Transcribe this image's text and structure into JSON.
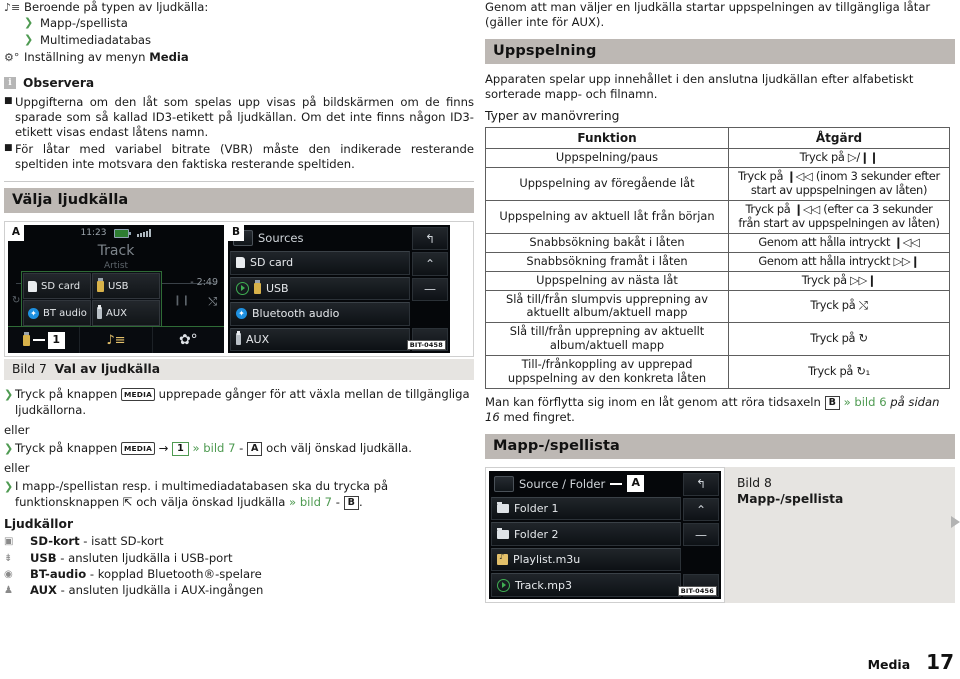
{
  "left": {
    "intro": {
      "icon": "playlist-icon",
      "text": "Beroende på typen av ljudkälla:",
      "subitems": [
        "Mapp-/spellista",
        "Multimediadatabas"
      ],
      "setting_icon": "gear-icon",
      "setting_text_prefix": "Inställning av menyn ",
      "setting_text_bold": "Media"
    },
    "note": {
      "badge": "i",
      "title": "Observera",
      "items": [
        "Uppgifterna om den låt som spelas upp visas på bildskärmen om de finns sparade som så kallad ID3-etikett på ljudkällan. Om det inte finns någon ID3-etikett visas endast låtens namn.",
        "För låtar med variabel bitrate (VBR) måste den indikerade resterande speltiden inte motsvara den faktiska resterande speltiden."
      ]
    },
    "section_title": "Välja ljudkälla",
    "screen_a": {
      "label": "A",
      "time": "11:23",
      "track": "Track",
      "artist": "Artist",
      "remaining": "- 2:49",
      "popup_items": [
        {
          "label": "SD card",
          "icon": "sd-card-icon"
        },
        {
          "label": "USB",
          "icon": "usb-icon"
        },
        {
          "label": "BT audio",
          "icon": "bluetooth-icon"
        },
        {
          "label": "AUX",
          "icon": "aux-icon"
        }
      ],
      "callout_number": "1",
      "bottom_icons": [
        "usb-icon",
        "playlist-icon",
        "gear-icon"
      ]
    },
    "screen_b": {
      "label": "B",
      "title": "Sources",
      "back_icon": "back-arrow-icon",
      "items": [
        {
          "label": "SD card",
          "icon": "sd-card-icon",
          "playing": false
        },
        {
          "label": "USB",
          "icon": "usb-icon",
          "playing": true
        },
        {
          "label": "Bluetooth audio",
          "icon": "bluetooth-icon",
          "playing": false
        },
        {
          "label": "AUX",
          "icon": "aux-icon",
          "playing": false
        }
      ],
      "side_icons": [
        "up-chevron-icon",
        "scroll-handle-icon",
        "down-chevron-icon"
      ],
      "bit_code": "BIT-0458"
    },
    "caption": {
      "number": "Bild 7",
      "title": "Val av ljudkälla"
    },
    "steps": [
      {
        "pre": "Tryck på knappen ",
        "key": "MEDIA",
        "post": " upprepade gånger för att växla mellan de tillgängliga ljudkällorna."
      },
      {
        "pre": "Tryck på knappen ",
        "key": "MEDIA",
        "arrow": "→",
        "num": "1",
        "ref": "» bild 7",
        "dash": "-",
        "letter": "A",
        "post": " och välj önskad ljudkälla."
      },
      {
        "pre": "I mapp-/spellistan resp. i multimediadatabasen ska du trycka på funktionsknappen ",
        "glyph": "⇱",
        "mid": " och välja önskad ljudkälla ",
        "ref": "» bild 7",
        "dash": "-",
        "letter": "B",
        "post": "."
      }
    ],
    "or_label": "eller",
    "sources_title": "Ljudkällor",
    "sources": [
      {
        "icon": "sd-card-icon",
        "bold": "SD-kort",
        "rest": " - isatt SD-kort"
      },
      {
        "icon": "usb-icon",
        "bold": "USB",
        "rest": " - ansluten ljudkälla i USB-port"
      },
      {
        "icon": "bluetooth-icon",
        "bold": "BT-audio",
        "rest": " - kopplad Bluetooth®-spelare"
      },
      {
        "icon": "aux-icon",
        "bold": "AUX",
        "rest": " - ansluten ljudkälla i AUX-ingången"
      }
    ]
  },
  "right": {
    "intro": "Genom att man väljer en ljudkälla startar uppspelningen av tillgängliga låtar (gäller inte för AUX).",
    "section_playback": "Uppspelning",
    "playback_text": "Apparaten spelar upp innehållet i den anslutna ljudkällan efter alfabetiskt sorterade mapp- och filnamn.",
    "table_title": "Typer av manövrering",
    "table": {
      "headers": [
        "Funktion",
        "Åtgärd"
      ],
      "rows": [
        [
          "Uppspelning/paus",
          "Tryck på ▷/❙❙"
        ],
        [
          "Uppspelning av föregående låt",
          "Tryck på ❙◁◁ (inom 3 sekunder efter start av uppspelningen av låten)"
        ],
        [
          "Uppspelning av aktuell låt från början",
          "Tryck på ❙◁◁ (efter ca 3 sekunder från start av uppspelningen av låten)"
        ],
        [
          "Snabbsökning bakåt i låten",
          "Genom att hålla intryckt ❙◁◁"
        ],
        [
          "Snabbsökning framåt i låten",
          "Genom att hålla intryckt ▷▷❙"
        ],
        [
          "Uppspelning av nästa låt",
          "Tryck på ▷▷❙"
        ],
        [
          "Slå till/från slumpvis upprepning av aktuellt album/aktuell mapp",
          "Tryck på ⤭"
        ],
        [
          "Slå till/från upprepning av aktuellt album/aktuell mapp",
          "Tryck på ↻"
        ],
        [
          "Till-/frånkoppling av upprepad uppspelning av den konkreta låten",
          "Tryck på ↻₁"
        ]
      ]
    },
    "after_table": {
      "pre": "Man kan förflytta sig inom en låt genom att röra tidsaxeln ",
      "letter": "B",
      "ref": " » bild 6 ",
      "italic": "på sidan 16",
      "post": " med fingret."
    },
    "section_folder": "Mapp-/spellista",
    "screen_c": {
      "title": "Source / Folder",
      "label": "A",
      "back_icon": "back-arrow-icon",
      "items": [
        {
          "label": "Folder 1",
          "icon": "folder-icon",
          "playing": false
        },
        {
          "label": "Folder 2",
          "icon": "folder-icon",
          "playing": false
        },
        {
          "label": "Playlist.m3u",
          "icon": "playlist-file-icon",
          "playing": false
        },
        {
          "label": "Track.mp3",
          "icon": "play-icon",
          "playing": true
        }
      ],
      "bit_code": "BIT-0456"
    },
    "caption": {
      "number": "Bild 8",
      "title": "Mapp-/spellista"
    }
  },
  "footer": {
    "section": "Media",
    "page": "17"
  }
}
